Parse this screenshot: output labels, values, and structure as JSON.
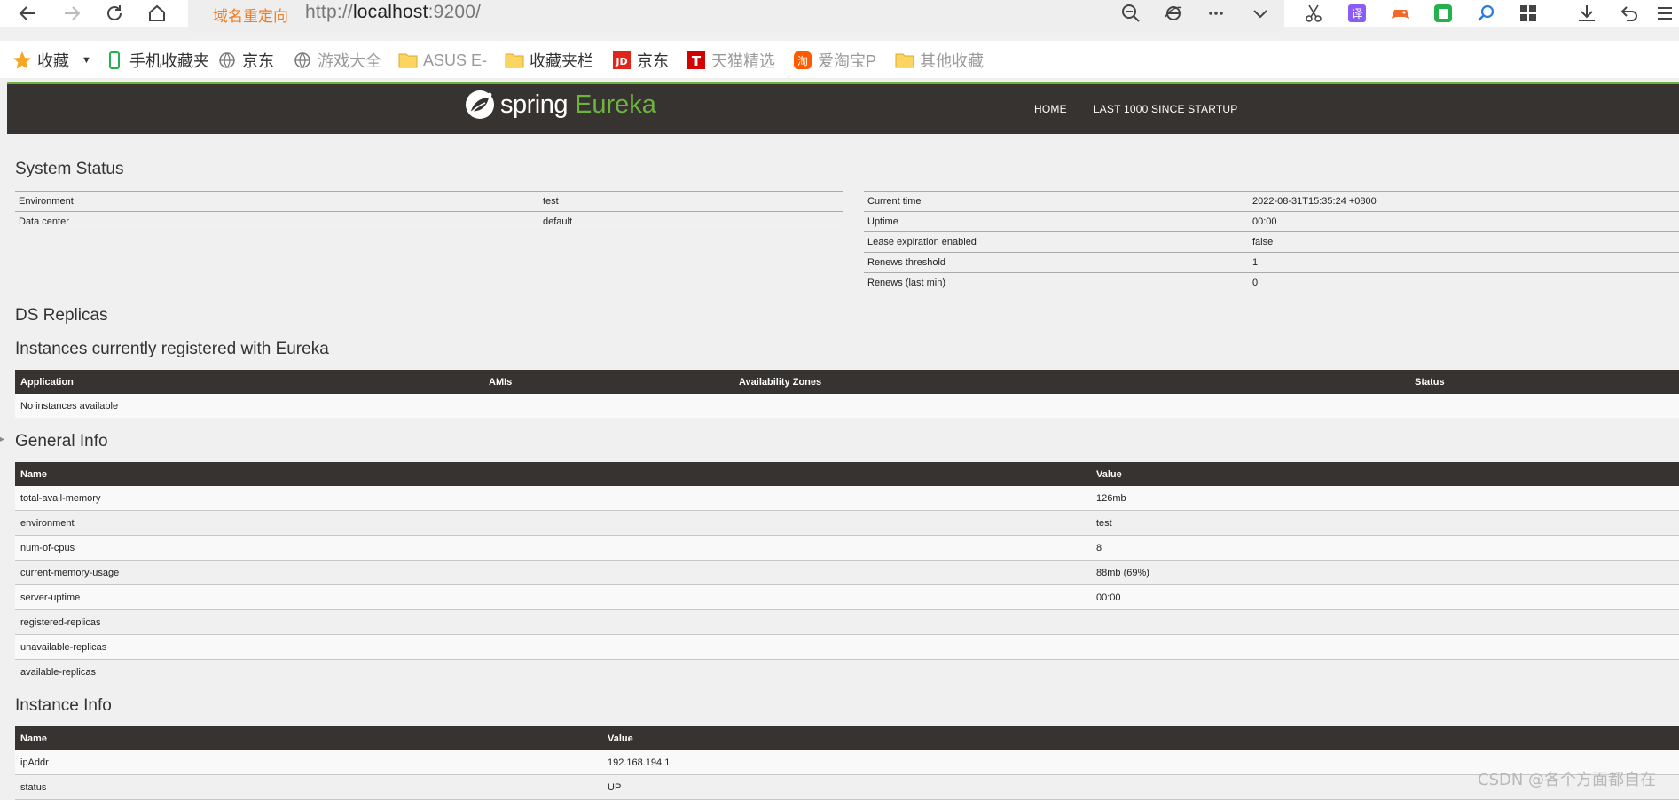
{
  "browser": {
    "redirect_label": "域名重定向",
    "url_prefix": "http://",
    "url_host": "localhost",
    "url_rest": ":9200/",
    "bookmarks": [
      {
        "label": "收藏"
      },
      {
        "label": "手机收藏夹"
      },
      {
        "label": "京东"
      },
      {
        "label": "游戏大全"
      },
      {
        "label": "ASUS E-"
      },
      {
        "label": "收藏夹栏"
      },
      {
        "label": "京东"
      },
      {
        "label": "天猫精选"
      },
      {
        "label": "爱淘宝P"
      },
      {
        "label": "其他收藏"
      }
    ]
  },
  "navbar": {
    "brand_spring": "spring",
    "brand_eureka": "Eureka",
    "links": [
      "HOME",
      "LAST 1000 SINCE STARTUP"
    ]
  },
  "system_status": {
    "heading": "System Status",
    "left": [
      {
        "name": "Environment",
        "value": "test"
      },
      {
        "name": "Data center",
        "value": "default"
      }
    ],
    "right": [
      {
        "name": "Current time",
        "value": "2022-08-31T15:35:24 +0800"
      },
      {
        "name": "Uptime",
        "value": "00:00"
      },
      {
        "name": "Lease expiration enabled",
        "value": "false"
      },
      {
        "name": "Renews threshold",
        "value": "1"
      },
      {
        "name": "Renews (last min)",
        "value": "0"
      }
    ]
  },
  "ds_replicas": {
    "heading": "DS Replicas"
  },
  "instances": {
    "heading": "Instances currently registered with Eureka",
    "columns": [
      "Application",
      "AMIs",
      "Availability Zones",
      "Status"
    ],
    "empty_text": "No instances available"
  },
  "general_info": {
    "heading": "General Info",
    "columns": [
      "Name",
      "Value"
    ],
    "rows": [
      {
        "name": "total-avail-memory",
        "value": "126mb"
      },
      {
        "name": "environment",
        "value": "test"
      },
      {
        "name": "num-of-cpus",
        "value": "8"
      },
      {
        "name": "current-memory-usage",
        "value": "88mb (69%)"
      },
      {
        "name": "server-uptime",
        "value": "00:00"
      },
      {
        "name": "registered-replicas",
        "value": ""
      },
      {
        "name": "unavailable-replicas",
        "value": ""
      },
      {
        "name": "available-replicas",
        "value": ""
      }
    ]
  },
  "instance_info": {
    "heading": "Instance Info",
    "columns": [
      "Name",
      "Value"
    ],
    "rows": [
      {
        "name": "ipAddr",
        "value": "192.168.194.1"
      },
      {
        "name": "status",
        "value": "UP"
      }
    ]
  },
  "watermark": "CSDN @各个方面都自在"
}
